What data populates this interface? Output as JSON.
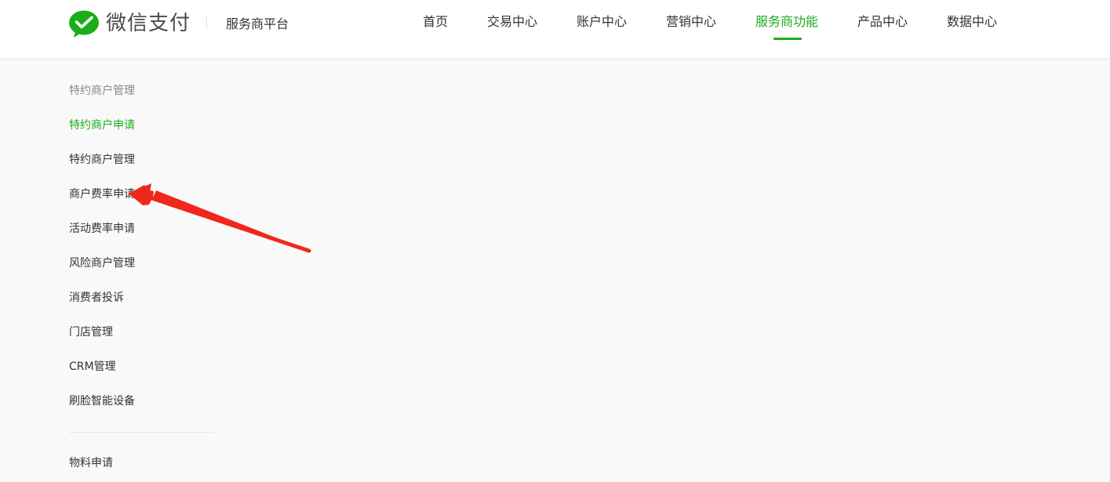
{
  "header": {
    "brand": "微信支付",
    "platform": "服务商平台",
    "nav": [
      {
        "label": "首页",
        "active": false
      },
      {
        "label": "交易中心",
        "active": false
      },
      {
        "label": "账户中心",
        "active": false
      },
      {
        "label": "营销中心",
        "active": false
      },
      {
        "label": "服务商功能",
        "active": true
      },
      {
        "label": "产品中心",
        "active": false
      },
      {
        "label": "数据中心",
        "active": false
      }
    ]
  },
  "sidebar": {
    "heading": "特约商户管理",
    "items": [
      {
        "label": "特约商户申请",
        "active": true
      },
      {
        "label": "特约商户管理",
        "active": false
      },
      {
        "label": "商户费率申请",
        "active": false
      },
      {
        "label": "活动费率申请",
        "active": false
      },
      {
        "label": "风险商户管理",
        "active": false
      },
      {
        "label": "消费者投诉",
        "active": false
      },
      {
        "label": "门店管理",
        "active": false
      },
      {
        "label": "CRM管理",
        "active": false
      },
      {
        "label": "刷脸智能设备",
        "active": false
      }
    ],
    "after_divider": [
      {
        "label": "物料申请",
        "active": false
      }
    ]
  },
  "colors": {
    "accent": "#1aad19",
    "arrow": "#f0281c"
  },
  "icons": {
    "logo": "wechat-pay-logo-icon",
    "annotation": "red-arrow-annotation"
  }
}
